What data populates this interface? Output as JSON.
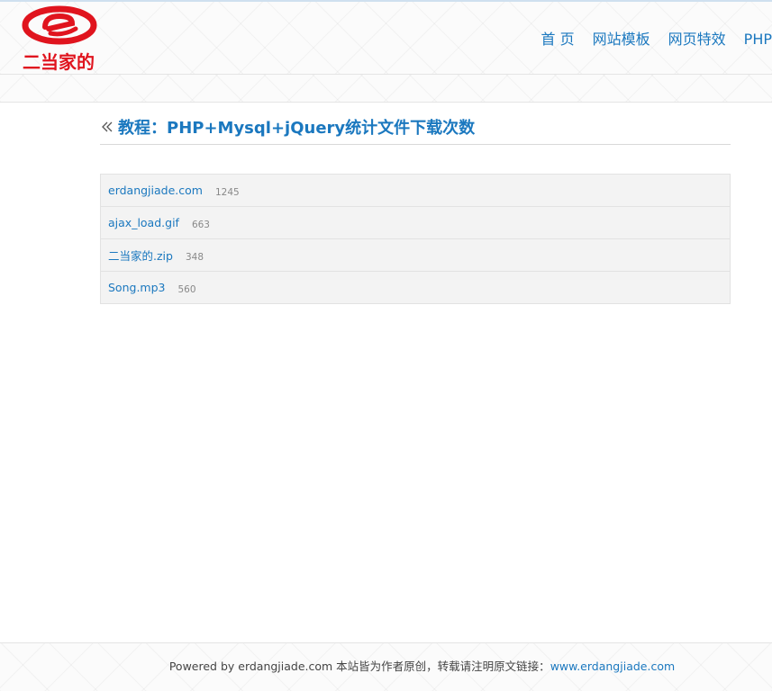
{
  "header": {
    "logo_text": "二当家的",
    "nav": [
      {
        "label": "首 页"
      },
      {
        "label": "网站模板"
      },
      {
        "label": "网页特效"
      },
      {
        "label": "PHP"
      }
    ]
  },
  "main": {
    "title": "教程：PHP+Mysql+jQuery统计文件下载次数",
    "files": [
      {
        "name": "erdangjiade.com",
        "count": "1245"
      },
      {
        "name": "ajax_load.gif",
        "count": "663"
      },
      {
        "name": "二当家的.zip",
        "count": "348"
      },
      {
        "name": "Song.mp3",
        "count": "560"
      }
    ]
  },
  "footer": {
    "text": "Powered by erdangjiade.com 本站皆为作者原创，转载请注明原文链接：",
    "link": "www.erdangjiade.com"
  },
  "colors": {
    "brand_red": "#e0141e",
    "link_blue": "#1b78bf"
  }
}
